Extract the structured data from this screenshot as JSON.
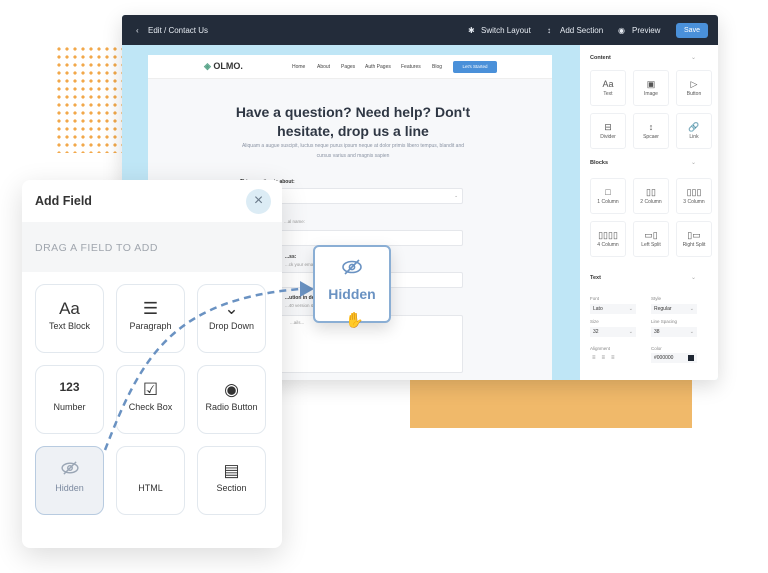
{
  "editor": {
    "breadcrumb": "Edit / Contact Us",
    "toolbar": {
      "switch_layout": "Switch Layout",
      "add_section": "Add Section",
      "preview": "Preview",
      "save": "Save"
    },
    "accent": "#4a90d9"
  },
  "site": {
    "logo": "OLMO.",
    "nav": [
      "Home",
      "About",
      "Pages",
      "Auth Pages",
      "Features",
      "Blog"
    ],
    "cta": "Let's Started",
    "heading": "Have a question? Need help? Don't hesitate, drop us a line",
    "subtext": "Aliquam a augue suscipit, luctus neque purus ipsum neque at dolor primis libero tempus, blandit and cursus varius and magnis sapien",
    "form": {
      "q1_label": "This question is about:",
      "q1_placeholder": "...bout...",
      "q2_label": "...al name:",
      "q3_label": "...ss:",
      "q3_help": "...ck your email a...",
      "q4_label": "...ution in detail",
      "q4_help": "...40 version & bu...",
      "q4_placeholder": "...ails..."
    }
  },
  "panel": {
    "content": {
      "title": "Content",
      "items": [
        {
          "label": "Text",
          "icon": "text-icon"
        },
        {
          "label": "Image",
          "icon": "image-icon"
        },
        {
          "label": "Button",
          "icon": "play-icon"
        },
        {
          "label": "Divider",
          "icon": "divider-icon"
        },
        {
          "label": "Spcaer",
          "icon": "spacer-icon"
        },
        {
          "label": "Link",
          "icon": "link-icon"
        }
      ]
    },
    "blocks": {
      "title": "Blocks",
      "items": [
        {
          "label": "1 Column"
        },
        {
          "label": "2 Column"
        },
        {
          "label": "3 Column"
        },
        {
          "label": "4 Column"
        },
        {
          "label": "Left Split"
        },
        {
          "label": "Right Split"
        }
      ]
    },
    "text": {
      "title": "Text",
      "font_label": "Font",
      "font": "Lato",
      "style_label": "Style",
      "style": "Regular",
      "size_label": "Size",
      "size": "32",
      "spacing_label": "Line Spacing",
      "spacing": "38",
      "align_label": "Alignment",
      "color_label": "Color",
      "color": "#000000"
    }
  },
  "add_field": {
    "title": "Add Field",
    "hint": "DRAG A FIELD TO ADD",
    "fields": [
      {
        "label": "Text Block",
        "icon": "Aa"
      },
      {
        "label": "Paragraph",
        "icon": "☰"
      },
      {
        "label": "Drop Down",
        "icon": "⌄"
      },
      {
        "label": "Number",
        "icon": "123"
      },
      {
        "label": "Check Box",
        "icon": "☑"
      },
      {
        "label": "Radio Button",
        "icon": "◉"
      },
      {
        "label": "Hidden",
        "icon": "eye-off"
      },
      {
        "label": "HTML",
        "icon": "</>"
      },
      {
        "label": "Section",
        "icon": "▤"
      }
    ],
    "selected": "Hidden",
    "dragging": "Hidden"
  }
}
